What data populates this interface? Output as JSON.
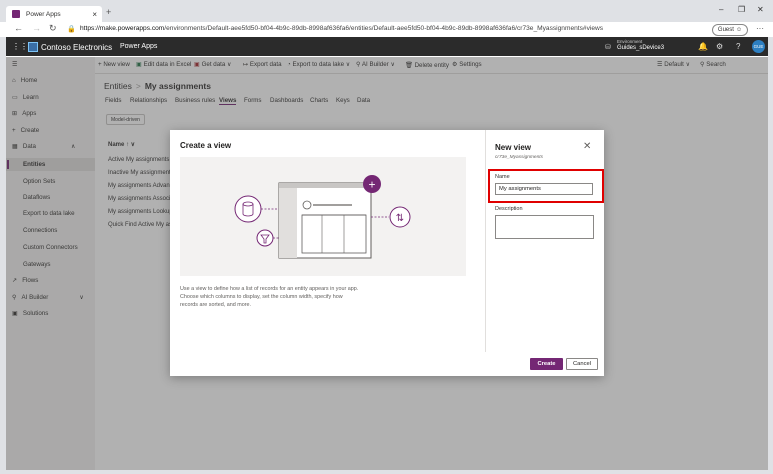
{
  "browser": {
    "tab_title": "Power Apps",
    "tab_close": "×",
    "new_tab": "+",
    "url_host": "https://make.powerapps.com",
    "url_path": "/environments/Default-aee5fd50-bf04-4b9c-89db-8998af636fa6/entities/Default-aee5fd50-bf04-4b9c-89db-8998af636fa6/cr73e_Myassignments#views",
    "profile": "Guest",
    "more": "···",
    "minimize": "–",
    "maximize": "❐",
    "close": "✕"
  },
  "header": {
    "org": "Contoso Electronics",
    "product": "Power Apps",
    "env_label": "Environment",
    "env_value": "Guides_sDevice3",
    "avatar_initials": "GUE"
  },
  "commands": [
    "+ New view",
    "Edit data in Excel",
    "Get data",
    "Export data",
    "Export to data lake",
    "AI Builder",
    "Delete entity",
    "Settings"
  ],
  "view_default": "Default",
  "search_label": "Search",
  "nav": {
    "items": [
      "Home",
      "Learn",
      "Apps",
      "Create",
      "Data"
    ],
    "data_sub": [
      "Entities",
      "Option Sets",
      "Dataflows",
      "Export to data lake",
      "Connections",
      "Custom Connectors",
      "Gateways"
    ],
    "bottom": [
      "Flows",
      "AI Builder",
      "Solutions"
    ]
  },
  "page": {
    "breadcrumb_root": "Entities",
    "breadcrumb_sep": ">",
    "breadcrumb_current": "My assignments",
    "tabs": [
      "Fields",
      "Relationships",
      "Business rules",
      "Views",
      "Forms",
      "Dashboards",
      "Charts",
      "Keys",
      "Data"
    ],
    "selected_tab": "Views",
    "filter_pill": "Model-driven",
    "column_header": "Name ↑ ∨",
    "rows": [
      "Active My assignments",
      "Inactive My assignments",
      "My assignments Advance",
      "My assignments Associat",
      "My assignments Lookup V",
      "Quick Find Active My ass"
    ]
  },
  "dialog": {
    "title": "Create a view",
    "description": "Use a view to define how a list of records for an entity appears in your app. Choose which columns to display, set the column width, specify how records are sorted, and more.",
    "panel_title": "New view",
    "panel_subtitle": "cr73e_Myassignments",
    "close": "✕",
    "name_label": "Name",
    "name_value": "My assignments",
    "description_label": "Description",
    "description_value": "",
    "create_label": "Create",
    "cancel_label": "Cancel"
  },
  "colors": {
    "accent": "#742774",
    "highlight": "#e00000",
    "appbar": "#2b2b2b"
  }
}
